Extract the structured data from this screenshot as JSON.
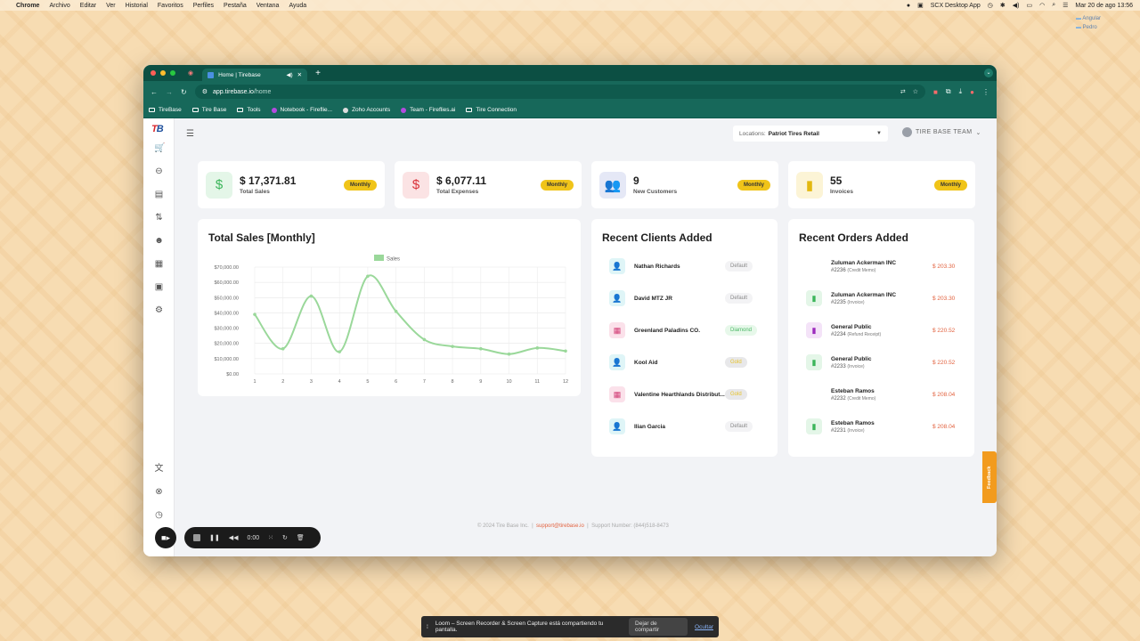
{
  "menubar": {
    "items": [
      "Chrome",
      "Archivo",
      "Editar",
      "Ver",
      "Historial",
      "Favoritos",
      "Perfiles",
      "Pestaña",
      "Ventana",
      "Ayuda"
    ],
    "app_label": "SCX Desktop App",
    "datetime": "Mar 20 de ago  13:56"
  },
  "desktop": {
    "folders": [
      "Angular",
      "Pedro"
    ]
  },
  "browser": {
    "tab_title": "Home | Tirebase",
    "url_host": "app.tirebase.io",
    "url_path": "/home",
    "bookmarks": [
      "TireBase",
      "Tire Base",
      "Tools",
      "Notebook - Fireflie...",
      "Zoho Accounts",
      "Team - Fireflies.ai",
      "Tire Connection"
    ]
  },
  "header": {
    "location_label": "Locations:",
    "location_value": "Patriot Tires Retail",
    "team_name": "TIRE BASE TEAM"
  },
  "logo": {
    "text_a": "T",
    "text_b": "B"
  },
  "stats": [
    {
      "value": "$ 17,371.81",
      "label": "Total Sales",
      "badge": "Monthly",
      "icon": "dollar-icon",
      "color": "#3bb55a",
      "bg": "#e4f6e8"
    },
    {
      "value": "$ 6,077.11",
      "label": "Total Expenses",
      "badge": "Monthly",
      "icon": "dollar-icon",
      "color": "#d9323a",
      "bg": "#fbe3e4"
    },
    {
      "value": "9",
      "label": "New Customers",
      "badge": "Monthly",
      "icon": "users-icon",
      "color": "#4b5fb0",
      "bg": "#e5e8f6"
    },
    {
      "value": "55",
      "label": "Invoices",
      "badge": "Monthly",
      "icon": "invoice-icon",
      "color": "#e3b80f",
      "bg": "#fcf4d6"
    }
  ],
  "sales_chart": {
    "title": "Total Sales [Monthly]"
  },
  "chart_data": {
    "type": "line",
    "title": "Total Sales [Monthly]",
    "legend": "Sales",
    "x": [
      "1",
      "2",
      "3",
      "4",
      "5",
      "6",
      "7",
      "8",
      "9",
      "10",
      "11",
      "12"
    ],
    "series": [
      {
        "name": "Sales",
        "values": [
          39000,
          16500,
          51000,
          14500,
          64000,
          41000,
          22500,
          18000,
          16500,
          13000,
          17000,
          15000
        ]
      }
    ],
    "yticks": [
      "$70,000.00",
      "$60,000.00",
      "$50,000.00",
      "$40,000.00",
      "$30,000.00",
      "$20,000.00",
      "$10,000.00",
      "$0.00"
    ],
    "ylim": [
      0,
      70000
    ],
    "grid": true,
    "legend_position": "top-center",
    "color": "#9ad89a"
  },
  "clients": {
    "title": "Recent Clients Added",
    "items": [
      {
        "name": "Nathan Richards",
        "tag": "Default",
        "kind": "person"
      },
      {
        "name": "David MTZ JR",
        "tag": "Default",
        "kind": "person"
      },
      {
        "name": "Greenland Paladins CO.",
        "tag": "Diamond",
        "kind": "company"
      },
      {
        "name": "Kool Aid",
        "tag": "Gold",
        "kind": "person"
      },
      {
        "name": "Valentine Hearthlands Distribut...",
        "tag": "Gold",
        "kind": "company"
      },
      {
        "name": "Ilian Garcia",
        "tag": "Default",
        "kind": "person"
      }
    ]
  },
  "orders": {
    "title": "Recent Orders Added",
    "items": [
      {
        "name": "Zuluman Ackerman INC",
        "number": "#2236",
        "type": "(Credit Memo)",
        "amount": "$ 203.30",
        "icon": "none"
      },
      {
        "name": "Zuluman Ackerman INC",
        "number": "#2235",
        "type": "(Invoice)",
        "amount": "$ 203.30",
        "icon": "invoice"
      },
      {
        "name": "General Public",
        "number": "#2234",
        "type": "(Refund Receipt)",
        "amount": "$ 220.52",
        "icon": "refund"
      },
      {
        "name": "General Public",
        "number": "#2233",
        "type": "(Invoice)",
        "amount": "$ 220.52",
        "icon": "invoice"
      },
      {
        "name": "Esteban Ramos",
        "number": "#2232",
        "type": "(Credit Memo)",
        "amount": "$ 208.04",
        "icon": "none"
      },
      {
        "name": "Esteban Ramos",
        "number": "#2231",
        "type": "(Invoice)",
        "amount": "$ 208.04",
        "icon": "invoice"
      }
    ]
  },
  "footer": {
    "copyright": "© 2024 Tire Base Inc.",
    "email": "support@tirebase.io",
    "support": "Support Number: (844)518-8473"
  },
  "feedback_label": "Feedback",
  "recorder": {
    "time": "0:00"
  },
  "loom_bar": {
    "message": "Loom – Screen Recorder & Screen Capture está compartiendo tu pantalla.",
    "stop": "Dejar de compartir",
    "hide": "Ocultar"
  }
}
